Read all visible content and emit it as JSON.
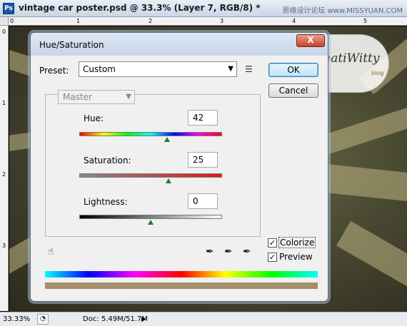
{
  "app": {
    "logo_text": "Ps",
    "doc_title": "vintage car poster.psd @ 33.3% (Layer 7, RGB/8) *",
    "watermark_site": "思缘设计论坛 www.MISSYUAN.COM"
  },
  "rulers": {
    "top_numbers": [
      "0",
      "1",
      "2",
      "3",
      "4",
      "5"
    ],
    "left_numbers": [
      "0",
      "1",
      "2",
      "3"
    ]
  },
  "badge": {
    "text": "CreatiWitty",
    "sub": "blog"
  },
  "dialog": {
    "title": "Hue/Saturation",
    "close_label": "X",
    "preset_label": "Preset:",
    "preset_value": "Custom",
    "preset_options_icon": "preset-options-icon",
    "ok_label": "OK",
    "cancel_label": "Cancel",
    "channel_value": "Master",
    "hue": {
      "label": "Hue:",
      "value": "42",
      "min": -180,
      "max": 180
    },
    "saturation": {
      "label": "Saturation:",
      "value": "25",
      "min": -100,
      "max": 100
    },
    "lightness": {
      "label": "Lightness:",
      "value": "0",
      "min": -100,
      "max": 100
    },
    "colorize_label": "Colorize",
    "colorize_checked": true,
    "preview_label": "Preview",
    "preview_checked": true,
    "colorize_color": "#a38f6a"
  },
  "status": {
    "zoom": "33.33%",
    "doc_info": "Doc: 5.49M/51.7M",
    "arrow": "▶"
  }
}
